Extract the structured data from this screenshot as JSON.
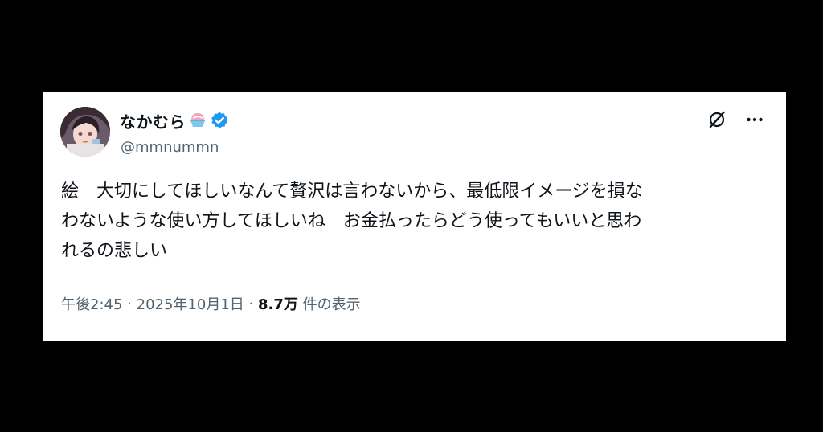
{
  "author": {
    "display_name": "なかむら",
    "name_emoji": "shaved-ice-emoji",
    "verified_icon": "verified-badge-icon",
    "handle": "@mmnummn"
  },
  "tweet": {
    "text": "絵　大切にしてほしいなんて贅沢は言わないから、最低限イメージを損な\nわないような使い方してほしいね　お金払ったらどう使ってもいいと思わ\nれるの悲しい"
  },
  "meta": {
    "time": "午後2:45",
    "separator": "·",
    "date": "2025年10月1日",
    "views_count": "8.7万",
    "views_label": "件の表示"
  },
  "icons": {
    "grok_icon": "grok-icon",
    "more_icon": "more-icon"
  },
  "colors": {
    "background": "#000000",
    "card": "#ffffff",
    "text_primary": "#0f1419",
    "text_secondary": "#536471",
    "verified_blue": "#1d9bf0"
  }
}
